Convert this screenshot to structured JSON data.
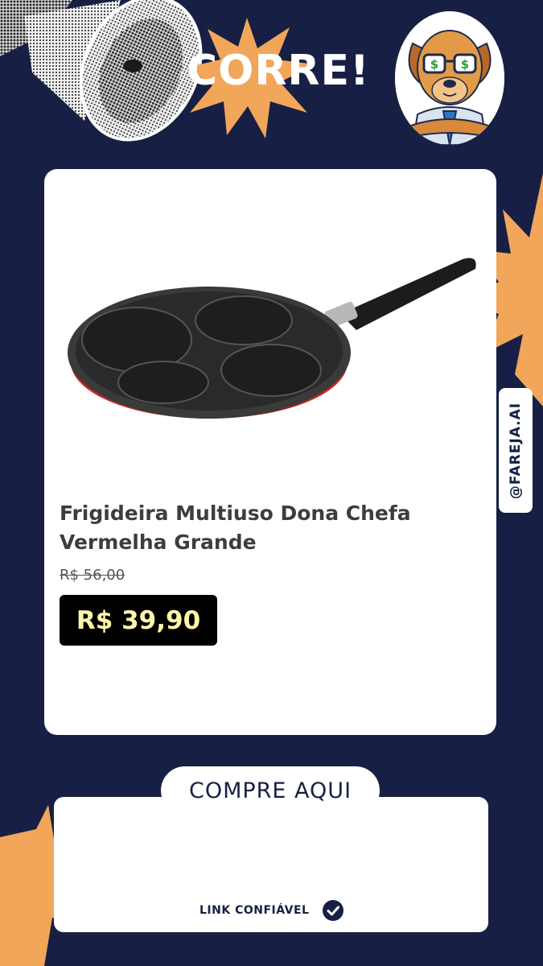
{
  "header": {
    "headline": "CORRE!",
    "megaphone_icon": "megaphone-icon",
    "mascot_icon": "dog-mascot-icon"
  },
  "product": {
    "image_icon": "frying-pan-icon",
    "title": "Frigideira Multiuso Dona Chefa Vermelha Grande",
    "old_price": "R$ 56,00",
    "price": "R$ 39,90"
  },
  "brand": {
    "handle": "@FAREJA.AI"
  },
  "cta": {
    "label": "COMPRE AQUI",
    "trust_label": "LINK CONFIÁVEL",
    "trust_icon": "check-circle-icon"
  },
  "colors": {
    "background": "#172044",
    "accent_star": "#f2a65a",
    "card": "#ffffff",
    "price_text": "#fff7a8",
    "price_box": "#000000"
  }
}
